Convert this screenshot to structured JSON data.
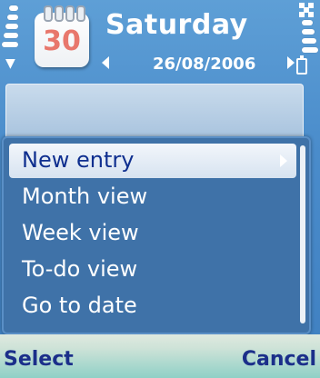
{
  "header": {
    "title": "Saturday",
    "date": "26/08/2006",
    "calendar_icon_day": "30"
  },
  "menu": {
    "items": [
      {
        "label": "New entry",
        "selected": true,
        "has_submenu": true
      },
      {
        "label": "Month view",
        "selected": false,
        "has_submenu": false
      },
      {
        "label": "Week view",
        "selected": false,
        "has_submenu": false
      },
      {
        "label": "To-do view",
        "selected": false,
        "has_submenu": false
      },
      {
        "label": "Go to date",
        "selected": false,
        "has_submenu": false
      }
    ]
  },
  "softkeys": {
    "left_label": "Select",
    "right_label": "Cancel"
  },
  "icons": {
    "calendar": "calendar-icon",
    "signal": "signal-icon",
    "battery": "battery-icon",
    "date_prev": "chevron-left-icon",
    "date_next": "chevron-right-icon",
    "submenu": "chevron-right-icon"
  },
  "colors": {
    "background": "#4a8ccb",
    "menu_background": "#3f72a8",
    "selected_text": "#0f2f8f",
    "softkey_text": "#1b2f8a",
    "calendar_day": "#e8776c"
  }
}
